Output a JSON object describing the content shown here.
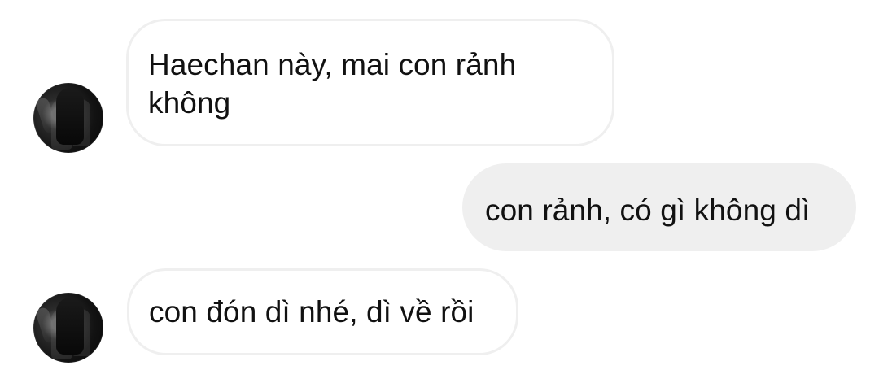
{
  "chat": {
    "messages": [
      {
        "sender": "incoming",
        "text": "Haechan này, mai con rảnh không",
        "avatar": "contact-avatar"
      },
      {
        "sender": "outgoing",
        "text": "con rảnh, có gì không dì"
      },
      {
        "sender": "incoming",
        "text": "con đón dì nhé, dì về rồi",
        "avatar": "contact-avatar"
      }
    ]
  }
}
